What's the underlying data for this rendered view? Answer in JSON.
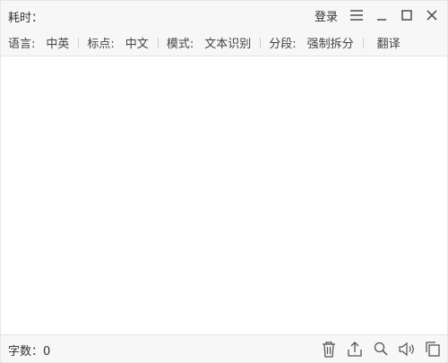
{
  "titlebar": {
    "elapsed_label": "耗时：",
    "login_label": "登录",
    "menu_icon": "menu-icon",
    "minimize_icon": "minimize-icon",
    "maximize_icon": "maximize-icon",
    "close_icon": "close-icon"
  },
  "toolbar": {
    "language_label": "语言:",
    "language_value": "中英",
    "punctuation_label": "标点:",
    "punctuation_value": "中文",
    "mode_label": "模式:",
    "mode_value": "文本识别",
    "segment_label": "分段:",
    "segment_value": "强制拆分",
    "translate_label": "翻译"
  },
  "footer": {
    "wordcount_label": "字数：",
    "wordcount_value": "0",
    "icons": [
      "trash-icon",
      "export-icon",
      "search-icon",
      "speaker-icon",
      "copy-icon"
    ]
  },
  "colors": {
    "bar_bg": "#f7f7f7",
    "border": "#e4e4e4",
    "text": "#333333",
    "icon": "#555555"
  }
}
